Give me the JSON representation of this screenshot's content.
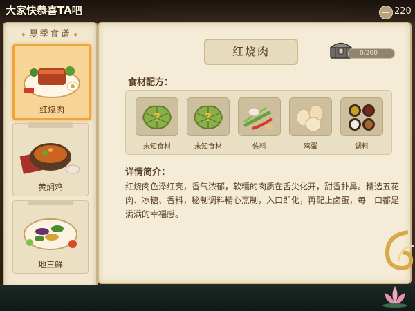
{
  "banner": {
    "message": "大家快恭喜TA吧",
    "coins": "220"
  },
  "sidebar": {
    "title": "夏季食谱",
    "dishes": [
      {
        "label": "红烧肉",
        "active": true
      },
      {
        "label": "黄焖鸡",
        "active": false
      },
      {
        "label": "地三鲜",
        "active": false
      }
    ]
  },
  "recipe": {
    "title": "红烧肉",
    "progress": "0/200",
    "ingredients_label": "食材配方：",
    "ingredients": [
      {
        "name": "未知食材",
        "icon": "unknown-ingredient-icon"
      },
      {
        "name": "未知食材",
        "icon": "unknown-ingredient-icon"
      },
      {
        "name": "佐料",
        "icon": "seasoning-icon"
      },
      {
        "name": "鸡蛋",
        "icon": "egg-icon"
      },
      {
        "name": "调料",
        "icon": "spice-jars-icon"
      }
    ],
    "detail_label": "详情简介：",
    "detail": "红烧肉色泽红亮，香气浓郁，软糯的肉质在舌尖化开，甜香扑鼻。精选五花肉、冰糖、香料，秘制调料精心烹制，入口即化，再配上卤蛋，每一口都是满满的幸福感。"
  }
}
